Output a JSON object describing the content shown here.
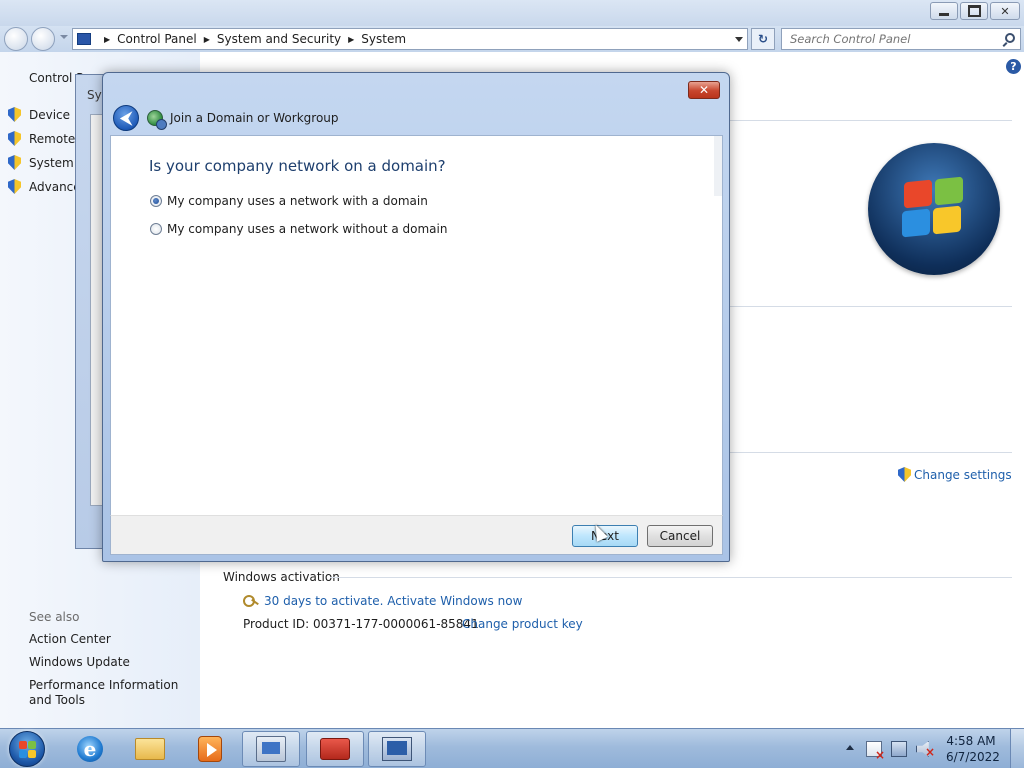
{
  "window": {
    "min_icon": "minimize-icon",
    "max_icon": "restore-icon",
    "close_label": "✕"
  },
  "address": {
    "crumbs": [
      "Control Panel",
      "System and Security",
      "System"
    ],
    "refresh_label": "↻",
    "search_placeholder": "Search Control Panel"
  },
  "leftpane": {
    "home": "Control P",
    "links": [
      "Device M",
      "Remote s",
      "System p",
      "Advance"
    ],
    "see_also": "See also",
    "see_also_links": [
      "Action Center",
      "Windows Update",
      "Performance Information and Tools"
    ]
  },
  "help_label": "?",
  "main": {
    "change_settings": "Change settings",
    "activation_heading": "Windows activation",
    "activate_link": "30 days to activate. Activate Windows now",
    "product_id": "Product ID: 00371-177-0000061-85841",
    "change_key": "Change product key"
  },
  "sysprops": {
    "title": "Sys"
  },
  "dialog": {
    "close_label": "✕",
    "back_label": "⮜",
    "title": "Join a Domain or Workgroup",
    "question": "Is your company network on a domain?",
    "options": [
      {
        "label": "My company uses a network with a domain",
        "checked": true
      },
      {
        "label": "My company uses a network without a domain",
        "checked": false
      }
    ],
    "next_label": "Next",
    "cancel_label": "Cancel"
  },
  "taskbar": {
    "ie_glyph": "e",
    "time": "4:58 AM",
    "date": "6/7/2022"
  }
}
